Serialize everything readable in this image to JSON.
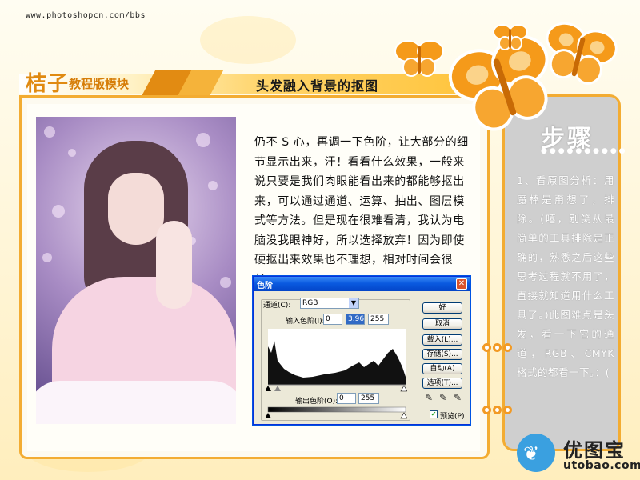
{
  "site": {
    "url": "www.photoshopcn.com/bbs"
  },
  "header": {
    "logo": "桔子",
    "logo_sub": "教程版模块",
    "title": "头发融入背景的抠图"
  },
  "article": {
    "text": "仍不 S 心，再调一下色阶，让大部分的细节显示出来，汗！看看什么效果，一般来说只要是我们肉眼能看出来的都能够抠出来，可以通过通道、运算、抽出、图层模式等方法。但是现在很难看清，我认为电脑没我眼神好，所以选择放弃！因为即使硬抠出来效果也不理想，相对时间会很长。"
  },
  "side": {
    "heading": "步骤",
    "dots": "●●●●●●●●●●",
    "text": "1、看原图分析：用魔棒是甭想了，排除。(嘻，别笑从最简单的工具排除是正确的，熟悉之后这些思考过程就不用了，直接就知道用什么工具了。)此图难点是头发，看一下它的通道，RGB、CMYK 格式的都看一下。：("
  },
  "dialog": {
    "title": "色阶",
    "close": "✕",
    "channel_label": "通道(C):",
    "channel_value": "RGB",
    "input_label": "输入色阶(I):",
    "input_values": [
      "0",
      "3.96",
      "255"
    ],
    "output_label": "输出色阶(O):",
    "output_values": [
      "0",
      "255"
    ],
    "buttons": {
      "ok": "好",
      "cancel": "取消",
      "load": "载入(L)...",
      "save": "存储(S)...",
      "auto": "自动(A)",
      "options": "选项(T)..."
    },
    "preview_label": "预览(P)",
    "preview_checked": "✔"
  },
  "watermark": {
    "name": "优图宝",
    "domain": "utobao.com"
  },
  "colors": {
    "accent": "#f3ac32",
    "butterfly": "#f59a1a",
    "side_panel": "#cfcfcf"
  }
}
